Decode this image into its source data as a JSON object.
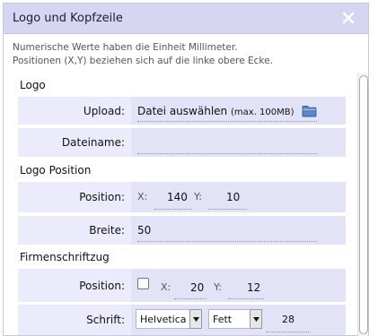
{
  "dialog": {
    "title": "Logo und Kopfzeile",
    "hint_line1": "Numerische Werte haben die Einheit Millimeter.",
    "hint_line2": "Positionen (X,Y) beziehen sich auf die linke obere Ecke."
  },
  "logo": {
    "section": "Logo",
    "upload_label": "Upload:",
    "upload_text": "Datei auswählen",
    "upload_note": "(max. 100MB)",
    "filename_label": "Dateiname:",
    "filename_value": ""
  },
  "logo_position": {
    "section": "Logo Position",
    "position_label": "Position:",
    "x_label": "X:",
    "x_value": "140",
    "y_label": "Y:",
    "y_value": "10",
    "width_label": "Breite:",
    "width_value": "50"
  },
  "company": {
    "section": "Firmenschriftzug",
    "position_label": "Position:",
    "x_label": "X:",
    "x_value": "20",
    "y_label": "Y:",
    "y_value": "12",
    "font_label": "Schrift:",
    "font_family": "Helvetica",
    "font_weight": "Fett",
    "font_size": "28"
  },
  "icons": {
    "close": "close-icon",
    "folder": "folder-icon",
    "dropdown": "chevron-down-icon"
  },
  "colors": {
    "titlebar": "#d6d6f2",
    "row_bg": "#ebebfb",
    "field_bg": "#e3e3f7",
    "folder": "#4a76b8"
  }
}
